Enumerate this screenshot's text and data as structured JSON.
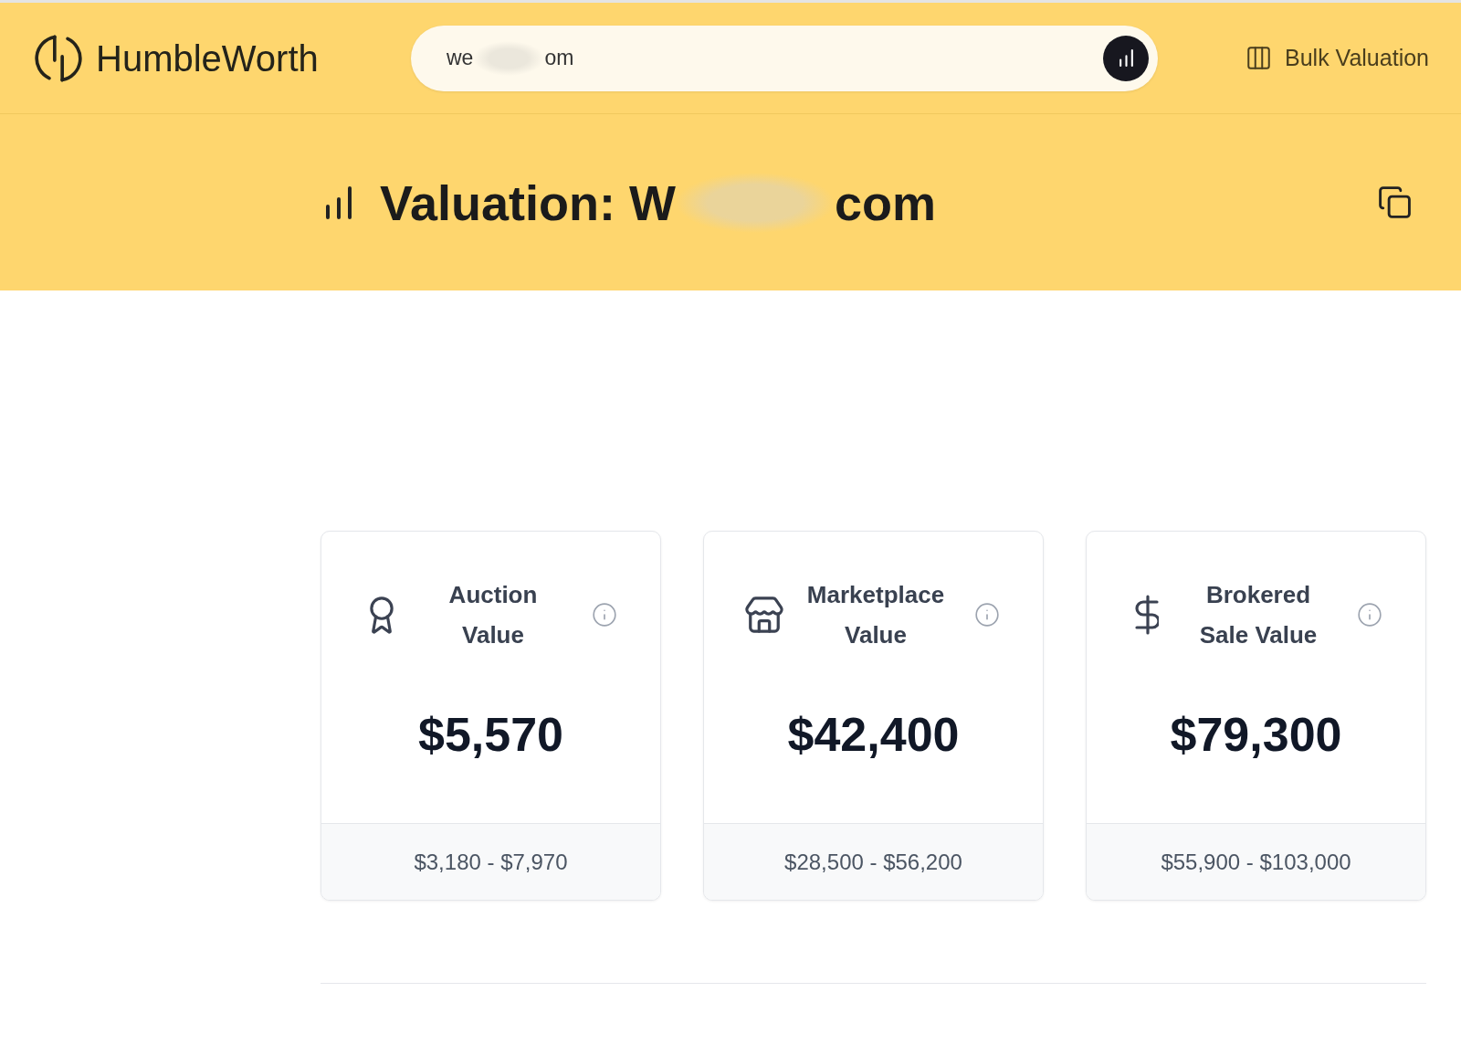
{
  "header": {
    "logo_text": "HumbleWorth",
    "search": {
      "value_parts": [
        "we",
        "om"
      ]
    },
    "bulk_valuation_link": "Bulk Valuation"
  },
  "title_band": {
    "title_parts": [
      "Valuation: W",
      "com"
    ]
  },
  "cards": [
    {
      "title": "Auction Value",
      "value": "$5,570",
      "range": "$3,180 - $7,970"
    },
    {
      "title": "Marketplace Value",
      "value": "$42,400",
      "range": "$28,500 - $56,200"
    },
    {
      "title": "Brokered Sale Value",
      "value": "$79,300",
      "range": "$55,900 - $103,000"
    }
  ]
}
